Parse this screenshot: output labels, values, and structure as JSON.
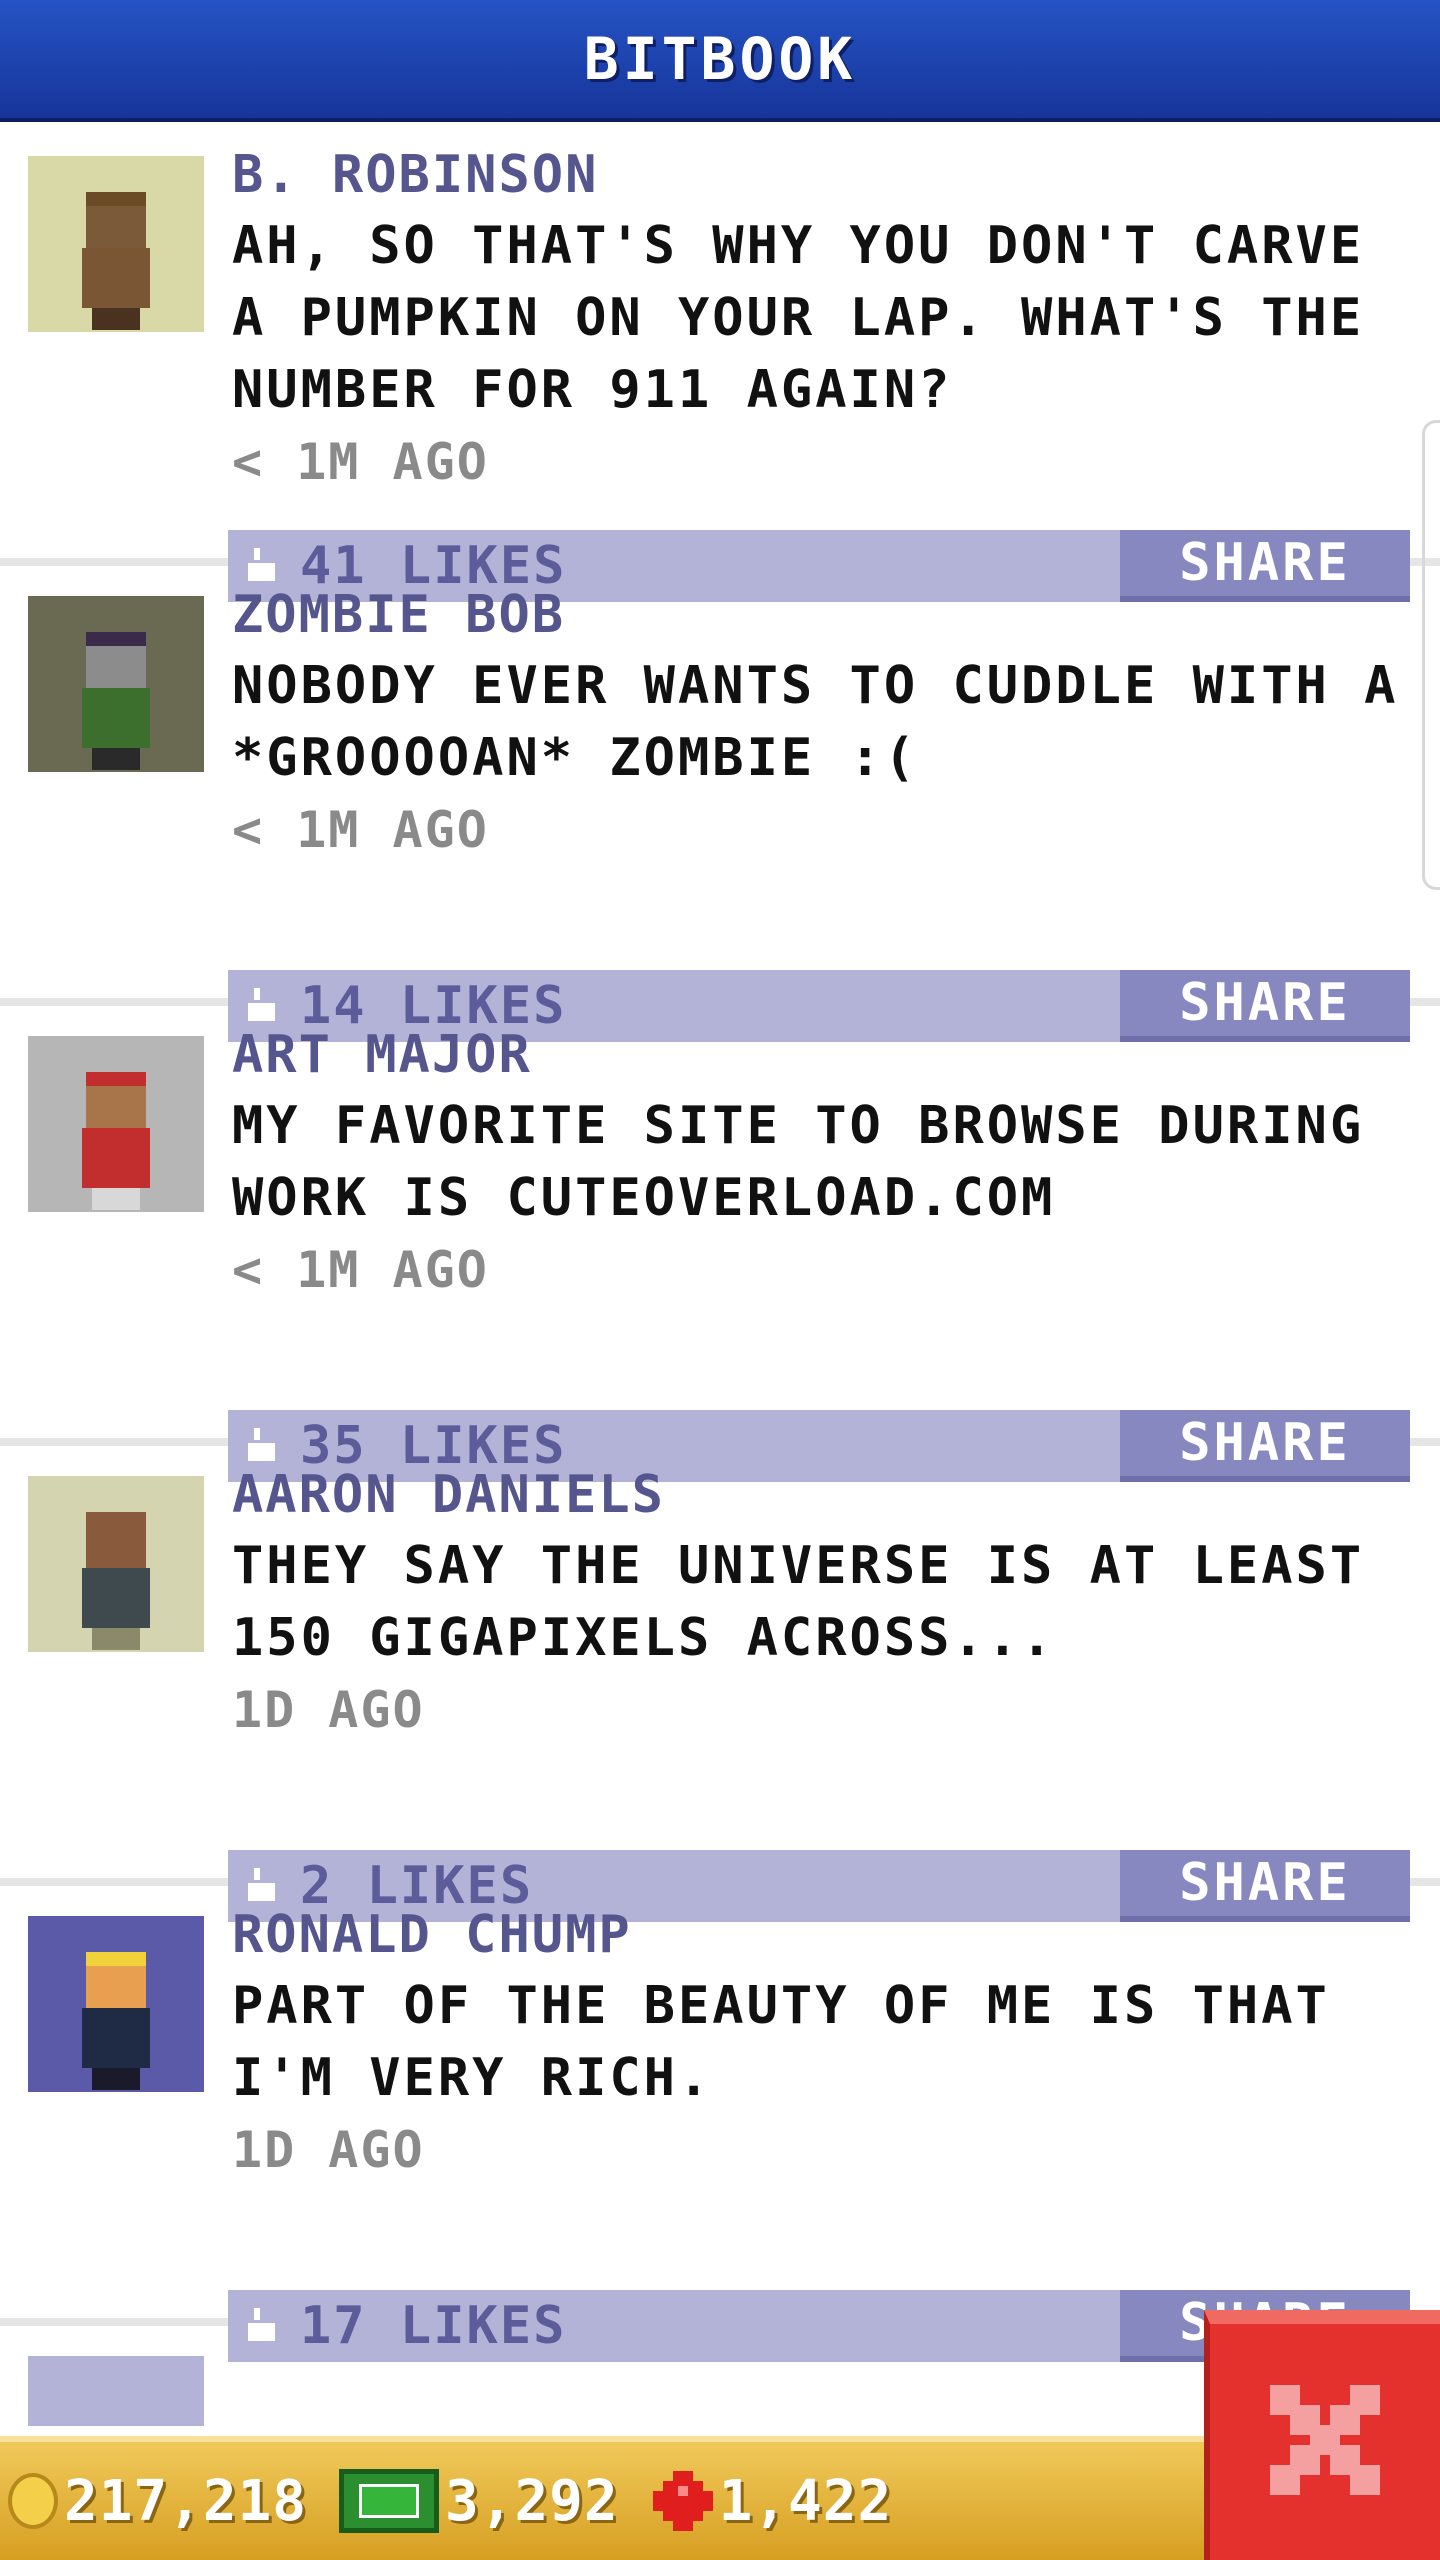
{
  "header": {
    "title": "BITBOOK"
  },
  "posts": [
    {
      "author": "B. ROBINSON",
      "message": "AH, SO THAT'S WHY YOU DON'T CARVE A PUMPKIN ON YOUR LAP. WHAT'S THE NUMBER FOR 911 AGAIN?",
      "time": "< 1M AGO",
      "likes": "41 LIKES",
      "share": "SHARE",
      "avatar_bg": "#d9d9a8"
    },
    {
      "author": "ZOMBIE BOB",
      "message": "NOBODY EVER WANTS TO CUDDLE WITH A *GROOOOAN* ZOMBIE :(",
      "time": "< 1M AGO",
      "likes": "14 LIKES",
      "share": "SHARE",
      "avatar_bg": "#6a6a52"
    },
    {
      "author": "ART MAJOR",
      "message": "MY FAVORITE SITE TO BROWSE DURING WORK IS CUTEOVERLOAD.COM",
      "time": "< 1M AGO",
      "likes": "35 LIKES",
      "share": "SHARE",
      "avatar_bg": "#b6b6b6"
    },
    {
      "author": "AARON DANIELS",
      "message": "THEY SAY THE UNIVERSE IS AT LEAST 150 GIGAPIXELS ACROSS...",
      "time": "1D AGO",
      "likes": "2 LIKES",
      "share": "SHARE",
      "avatar_bg": "#d4d4b0"
    },
    {
      "author": "RONALD CHUMP",
      "message": "PART OF THE BEAUTY OF ME IS THAT I'M VERY RICH.",
      "time": "1D AGO",
      "likes": "17 LIKES",
      "share": "SHARE",
      "avatar_bg": "#5a5aa8"
    }
  ],
  "currency": {
    "coins": "217,218",
    "bux": "3,292",
    "gems": "1,422"
  },
  "colors": {
    "header": "#1f47b8",
    "likes_bar": "#b3b3d8",
    "share_button": "#8888c0",
    "bottom_bar": "#e0b038",
    "close_button": "#e4312e"
  }
}
